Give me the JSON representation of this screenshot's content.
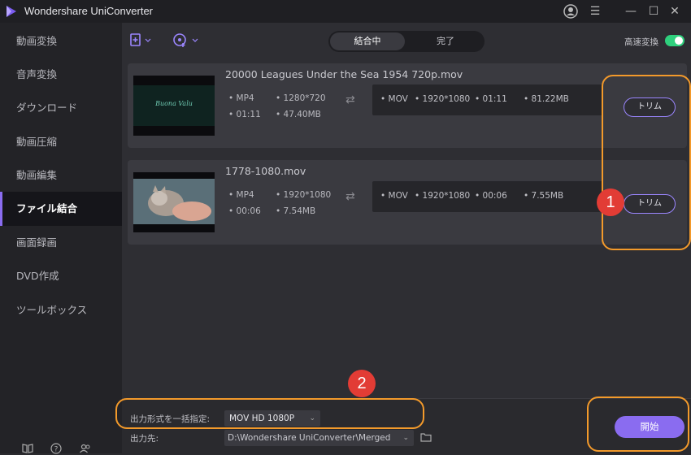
{
  "app": {
    "title": "Wondershare UniConverter"
  },
  "sidebar": {
    "items": [
      {
        "label": "動画変換"
      },
      {
        "label": "音声変換"
      },
      {
        "label": "ダウンロード"
      },
      {
        "label": "動画圧縮"
      },
      {
        "label": "動画編集"
      },
      {
        "label": "ファイル結合",
        "active": true
      },
      {
        "label": "画面録画"
      },
      {
        "label": "DVD作成"
      },
      {
        "label": "ツールボックス"
      }
    ],
    "bottom_icons": [
      "book-icon",
      "help-icon",
      "account-icon"
    ]
  },
  "toolbar": {
    "tabs": [
      {
        "label": "結合中",
        "active": true
      },
      {
        "label": "完了",
        "active": false
      }
    ],
    "speed_label": "高速変換",
    "speed_enabled": true
  },
  "files": [
    {
      "name": "20000 Leagues Under the Sea 1954 720p.mov",
      "thumb_text": "Buona Valu",
      "source": {
        "format": "MP4",
        "resolution": "1280*720",
        "duration": "01:11",
        "size": "47.40MB"
      },
      "target": {
        "format": "MOV",
        "resolution": "1920*1080",
        "duration": "01:11",
        "size": "81.22MB"
      },
      "trim_label": "トリム"
    },
    {
      "name": "1778-1080.mov",
      "source": {
        "format": "MP4",
        "resolution": "1920*1080",
        "duration": "00:06",
        "size": "7.54MB"
      },
      "target": {
        "format": "MOV",
        "resolution": "1920*1080",
        "duration": "00:06",
        "size": "7.55MB"
      },
      "trim_label": "トリム"
    }
  ],
  "bottom": {
    "format_label": "出力形式を一括指定:",
    "format_value": "MOV HD 1080P",
    "output_label": "出力先:",
    "output_path": "D:\\Wondershare UniConverter\\Merged",
    "start_label": "開始"
  },
  "annotations": {
    "badge1": "1",
    "badge2": "2",
    "highlight_color": "#f39a2b",
    "badge_color": "#e23c35"
  },
  "colors": {
    "accent": "#8a6cf0",
    "toggle_on": "#2fd07d"
  }
}
